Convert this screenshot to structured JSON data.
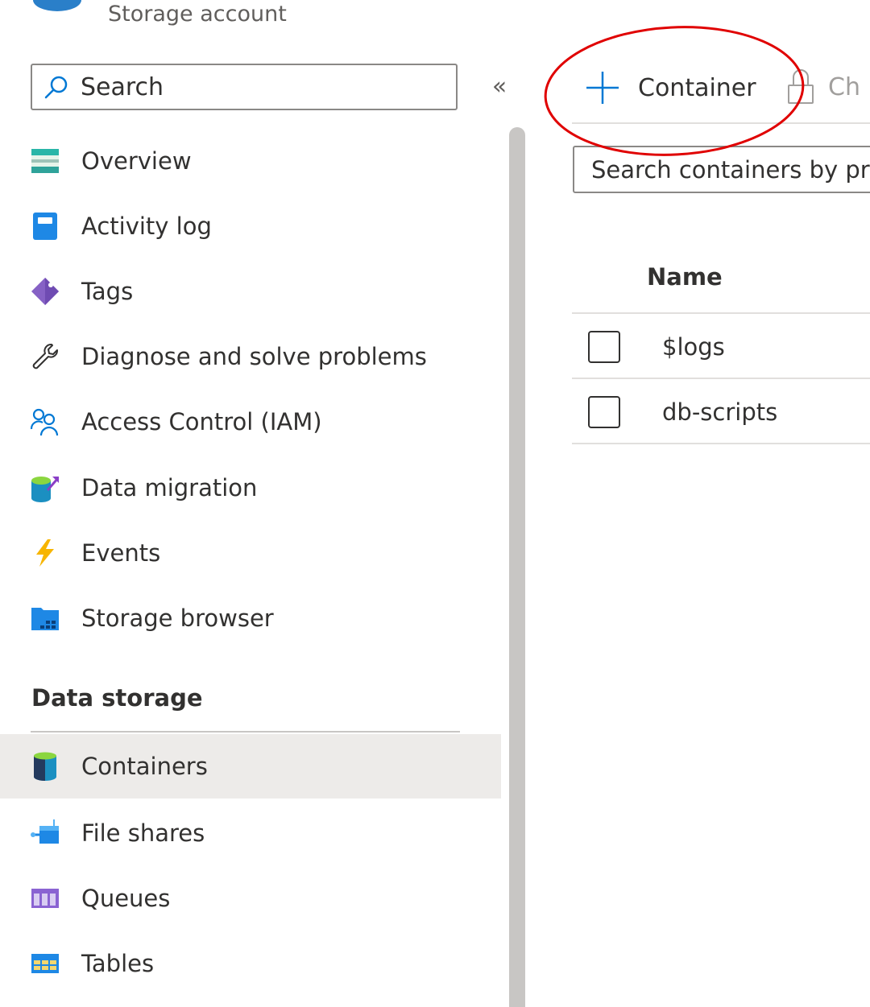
{
  "header": {
    "subtitle": "Storage account"
  },
  "sidebar": {
    "search_placeholder": "Search",
    "collapse_glyph": "«",
    "items": [
      {
        "label": "Overview",
        "icon": "overview-icon"
      },
      {
        "label": "Activity log",
        "icon": "activity-log-icon"
      },
      {
        "label": "Tags",
        "icon": "tag-icon"
      },
      {
        "label": "Diagnose and solve problems",
        "icon": "wrench-icon"
      },
      {
        "label": "Access Control (IAM)",
        "icon": "people-icon"
      },
      {
        "label": "Data migration",
        "icon": "data-migration-icon"
      },
      {
        "label": "Events",
        "icon": "lightning-icon"
      },
      {
        "label": "Storage browser",
        "icon": "storage-browser-icon"
      }
    ],
    "section_title": "Data storage",
    "section_items": [
      {
        "label": "Containers",
        "icon": "containers-icon",
        "active": true
      },
      {
        "label": "File shares",
        "icon": "file-shares-icon"
      },
      {
        "label": "Queues",
        "icon": "queues-icon"
      },
      {
        "label": "Tables",
        "icon": "tables-icon"
      }
    ]
  },
  "toolbar": {
    "add_container_label": "Container",
    "change_access_label": "Ch"
  },
  "filter": {
    "placeholder": "Search containers by pr"
  },
  "table": {
    "columns": [
      "Name"
    ],
    "rows": [
      {
        "name": "$logs"
      },
      {
        "name": "db-scripts"
      }
    ]
  },
  "colors": {
    "accent": "#0078d4",
    "annotation": "#e00000",
    "active_bg": "#edebe9"
  }
}
